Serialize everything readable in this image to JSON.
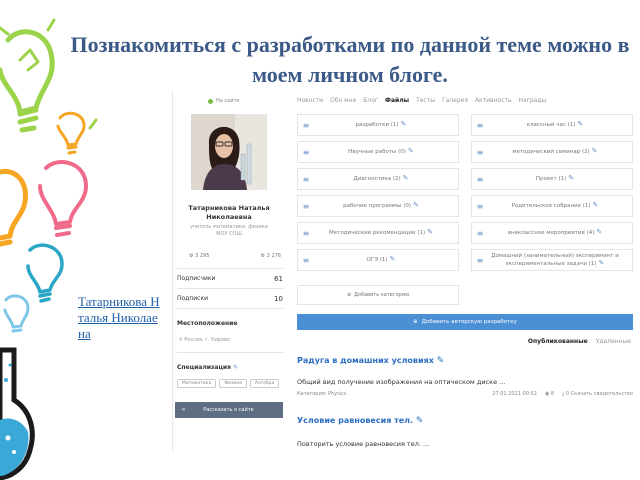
{
  "slide": {
    "title": "Познакомиться с разработками по данной теме можно в моем личном блоге.",
    "link_lines": [
      "Татарникова Н",
      "талья Николае",
      "на"
    ]
  },
  "profile": {
    "status": "На сайте",
    "name_line1": "Татарникова Наталья",
    "name_line2": "Николаевна",
    "subtitle_line1": "учитель математики, физики",
    "subtitle_line2": "МОУ СОШ",
    "stat1": "3 295",
    "stat2": "3 276",
    "subscribers_label": "Подписчики",
    "subscribers_value": "61",
    "subscriptions_label": "Подписки",
    "subscriptions_value": "10",
    "location_label": "Местоположение",
    "location_value": "Россия, г. Кирово",
    "specialization_label": "Специализация",
    "specialization_tags": [
      "Математика",
      "Физика",
      "Алгебра"
    ],
    "share_label": "Рассказать о сайте"
  },
  "tabs": {
    "items": [
      "Новости",
      "Обо мне",
      "Блог",
      "Файлы",
      "Тесты",
      "Галерея",
      "Активность",
      "Награды"
    ],
    "active": "Файлы"
  },
  "categories": {
    "left": [
      "разработки (1)",
      "Научные работы (0)",
      "Диагностика (2)",
      "рабочие программы (0)",
      "Методические рекомендации (1)",
      "ОГЭ (1)"
    ],
    "right": [
      "классный час (1)",
      "методический семинар (2)",
      "Проект (1)",
      "Родительское собрание (1)",
      "внеклассное мероприятие (4)",
      "Домашний (занимательный) эксперимент и экспериментальные задачи (1)"
    ]
  },
  "actions": {
    "add_category": "Добавить категорию",
    "add_development": "Добавить авторскую разработку"
  },
  "publish_tabs": {
    "published": "Опубликованные",
    "deleted": "Удаленные"
  },
  "posts": [
    {
      "title": "Радуга в домашних условиях",
      "description": "Общий вид получение изображения на оптическом диске ...",
      "category": "Категория: Physics",
      "date": "27.01.2021 00:52",
      "views": "8",
      "downloads": "0 Скачать свидетельство"
    },
    {
      "title": "Условие равновесия тел.",
      "description": "Повторить условие равновесия тел. ..."
    }
  ],
  "colors": {
    "title": "#3c5a88",
    "link": "#1f5fa8",
    "accent": "#4b8fd5",
    "post_title": "#2c6fc2"
  }
}
